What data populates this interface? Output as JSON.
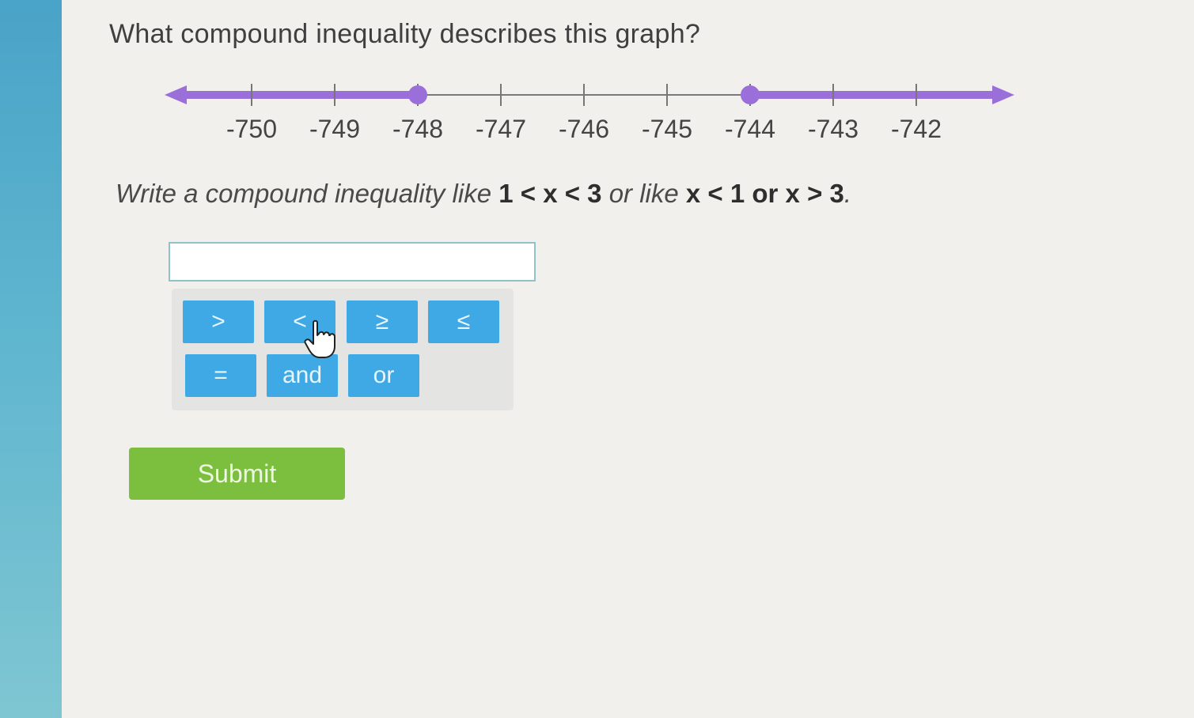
{
  "question": "What compound inequality describes this graph?",
  "number_line": {
    "ticks": [
      "-750",
      "-749",
      "-748",
      "-747",
      "-746",
      "-745",
      "-744",
      "-743",
      "-742"
    ],
    "left_ray": {
      "endpoint": -748,
      "closed": true,
      "direction": "left"
    },
    "right_ray": {
      "endpoint": -744,
      "closed": true,
      "direction": "right"
    },
    "accent_color": "#9b6fd9"
  },
  "instruction": {
    "prefix": "Write a compound inequality like",
    "example1": "1 < x < 3",
    "middle": "or like",
    "example2": "x < 1 or x > 3",
    "suffix": "."
  },
  "answer": {
    "value": "",
    "placeholder": ""
  },
  "keypad": {
    "gt": ">",
    "lt": "<",
    "ge": "≥",
    "le": "≤",
    "eq": "=",
    "and": "and",
    "or": "or"
  },
  "submit_label": "Submit",
  "colors": {
    "key": "#3fa9e6",
    "submit": "#7cbf3f",
    "line": "#9b6fd9"
  }
}
